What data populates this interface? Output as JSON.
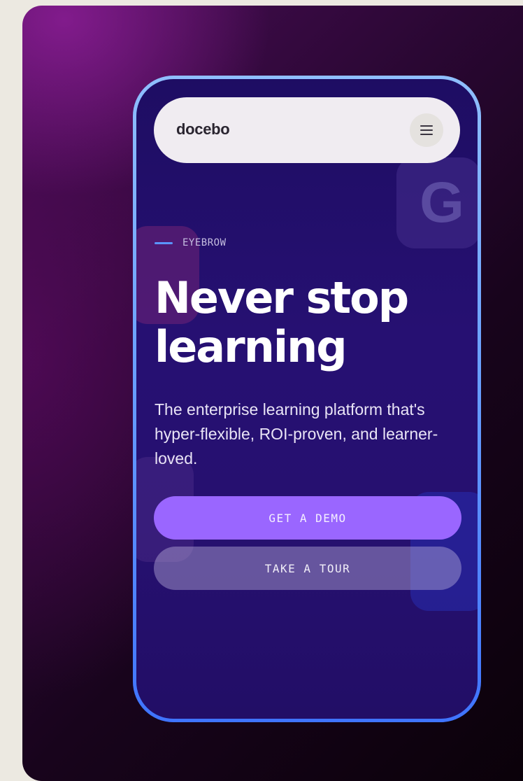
{
  "header": {
    "logo": "docebo",
    "menu_icon": "hamburger-menu-icon"
  },
  "decorations": {
    "g_tile_letter": "G"
  },
  "hero": {
    "eyebrow": "EYEBROW",
    "headline_line1": "Never stop",
    "headline_line2": "learning",
    "subtitle": "The enterprise learning platform that's hyper-flexible, ROI-proven, and learner-loved."
  },
  "buttons": {
    "demo": "GET A DEMO",
    "tour": "TAKE A TOUR"
  },
  "colors": {
    "phone_bg": "#261070",
    "phone_border_top": "#8fbfff",
    "phone_border_bottom": "#3f74ff",
    "primary_button": "#9a66ff",
    "eyebrow_accent": "#5a95ff",
    "page_bg": "#ece9e1"
  }
}
